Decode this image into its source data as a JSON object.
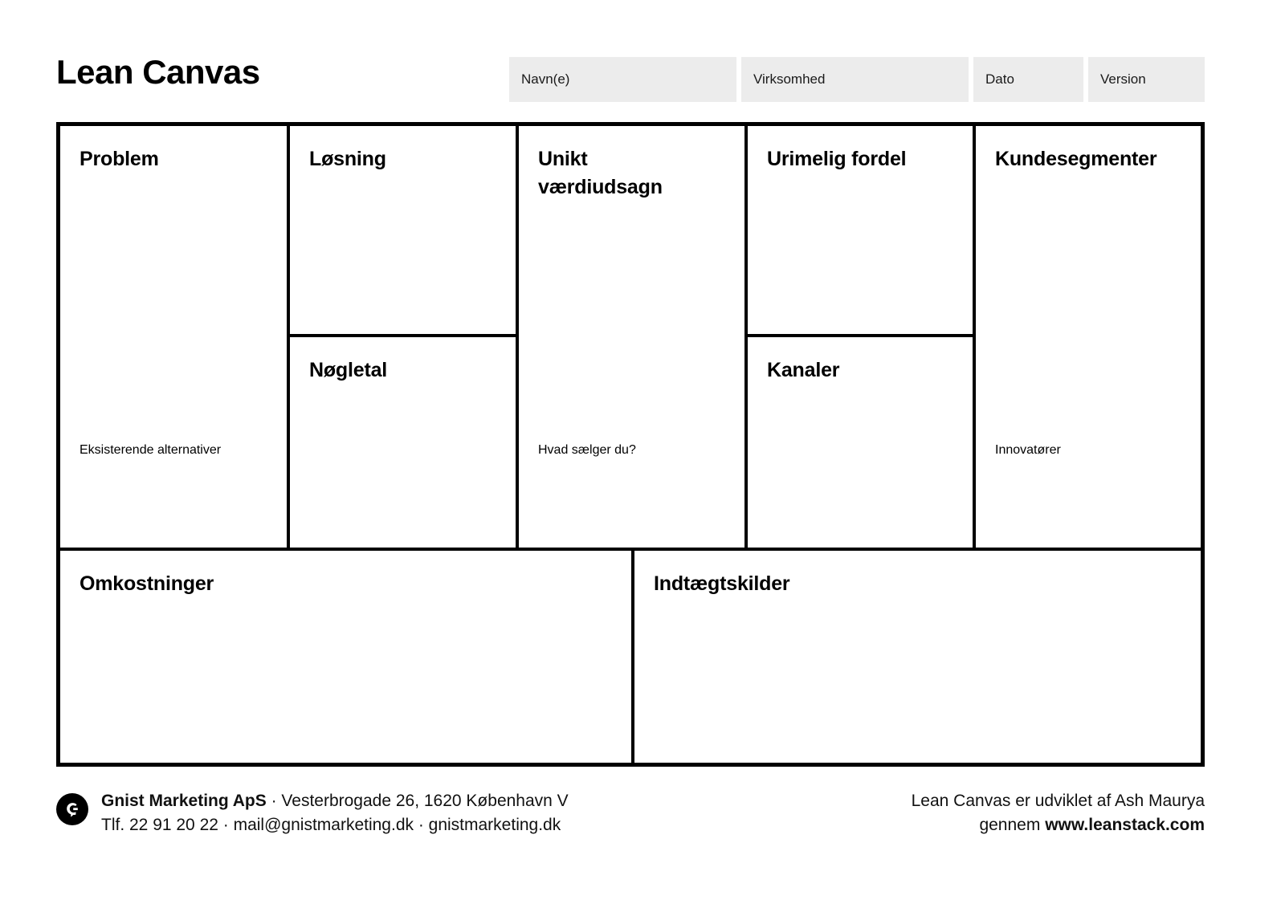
{
  "header": {
    "title": "Lean Canvas",
    "fields": [
      {
        "name": "navn",
        "placeholder": "Navn(e)",
        "value": ""
      },
      {
        "name": "virksomhed",
        "placeholder": "Virksomhed",
        "value": ""
      },
      {
        "name": "dato",
        "placeholder": "Dato",
        "value": ""
      },
      {
        "name": "version",
        "placeholder": "Version",
        "value": ""
      }
    ]
  },
  "canvas": {
    "cells": {
      "problem": {
        "title": "Problem",
        "sub": "Eksisterende alternativer",
        "body": ""
      },
      "losning": {
        "title": "Løsning",
        "sub": "",
        "body": ""
      },
      "nogletal": {
        "title": "Nøgletal",
        "sub": "",
        "body": ""
      },
      "unikt_vaerdiudsagn": {
        "title": "Unikt\nværdiudsagn",
        "sub": "Hvad sælger du?",
        "body": ""
      },
      "urimelig_fordel": {
        "title": "Urimelig fordel",
        "sub": "",
        "body": ""
      },
      "kanaler": {
        "title": "Kanaler",
        "sub": "",
        "body": ""
      },
      "kundesegmenter": {
        "title": "Kundesegmenter",
        "sub": "Innovatører",
        "body": ""
      },
      "omkostninger": {
        "title": "Omkostninger",
        "sub": "",
        "body": ""
      },
      "indtaegtskilder": {
        "title": "Indtægtskilder",
        "sub": "",
        "body": ""
      }
    }
  },
  "footer": {
    "company_name": "Gnist Marketing ApS",
    "address_line": " · Vesterbrogade 26, 1620 København V",
    "contact_line": "Tlf. 22 91 20 22 · mail@gnistmarketing.dk · gnistmarketing.dk",
    "logo_letter": "G",
    "credit_line_1": "Lean Canvas er udviklet af Ash Maurya",
    "credit_line_2_prefix": "gennem ",
    "credit_line_2_url": "www.leanstack.com"
  },
  "colors": {
    "ink": "#000000",
    "field_bg": "#ececec",
    "page_bg": "#ffffff"
  }
}
